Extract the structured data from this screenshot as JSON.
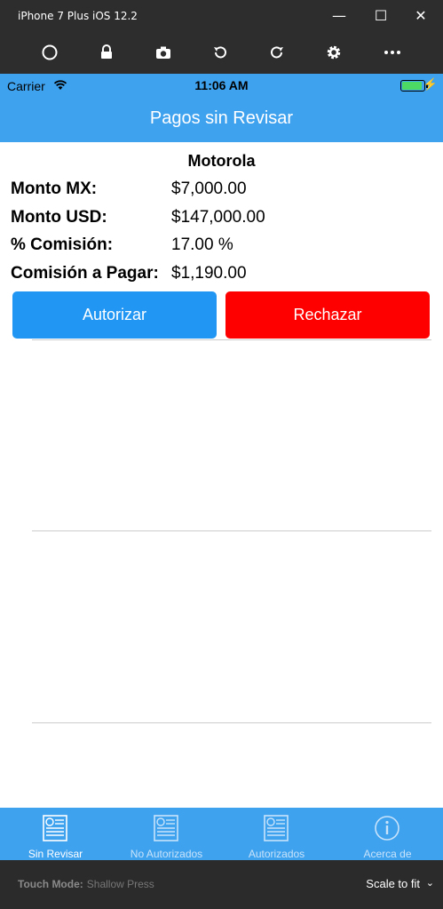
{
  "window": {
    "title": "iPhone 7 Plus iOS 12.2"
  },
  "toolbar": {
    "icons": [
      "home-circle-icon",
      "lock-icon",
      "camera-icon",
      "rotate-left-icon",
      "rotate-right-icon",
      "gear-icon",
      "more-icon"
    ]
  },
  "statusbar": {
    "carrier": "Carrier",
    "time": "11:06 AM"
  },
  "nav": {
    "title": "Pagos sin Revisar"
  },
  "payment": {
    "company": "Motorola",
    "rows": [
      {
        "label": "Monto MX:",
        "value": "$7,000.00"
      },
      {
        "label": "Monto USD:",
        "value": "$147,000.00"
      },
      {
        "label": "% Comisión:",
        "value": "17.00 %"
      },
      {
        "label": "Comisión a Pagar:",
        "value": "$1,190.00"
      }
    ],
    "authorize_label": "Autorizar",
    "reject_label": "Rechazar"
  },
  "colors": {
    "primary": "#3fa2ef",
    "authorize": "#2196f3",
    "reject": "#ff0000"
  },
  "tabs": [
    {
      "label": "Sin Revisar",
      "icon": "document-icon",
      "active": true
    },
    {
      "label": "No Autorizados",
      "icon": "document-icon",
      "active": false
    },
    {
      "label": "Autorizados",
      "icon": "document-icon",
      "active": false
    },
    {
      "label": "Acerca de",
      "icon": "info-icon",
      "active": false
    }
  ],
  "simbar": {
    "touch_mode_label": "Touch Mode:",
    "touch_mode_value": "Shallow Press",
    "scale": "Scale to fit"
  }
}
